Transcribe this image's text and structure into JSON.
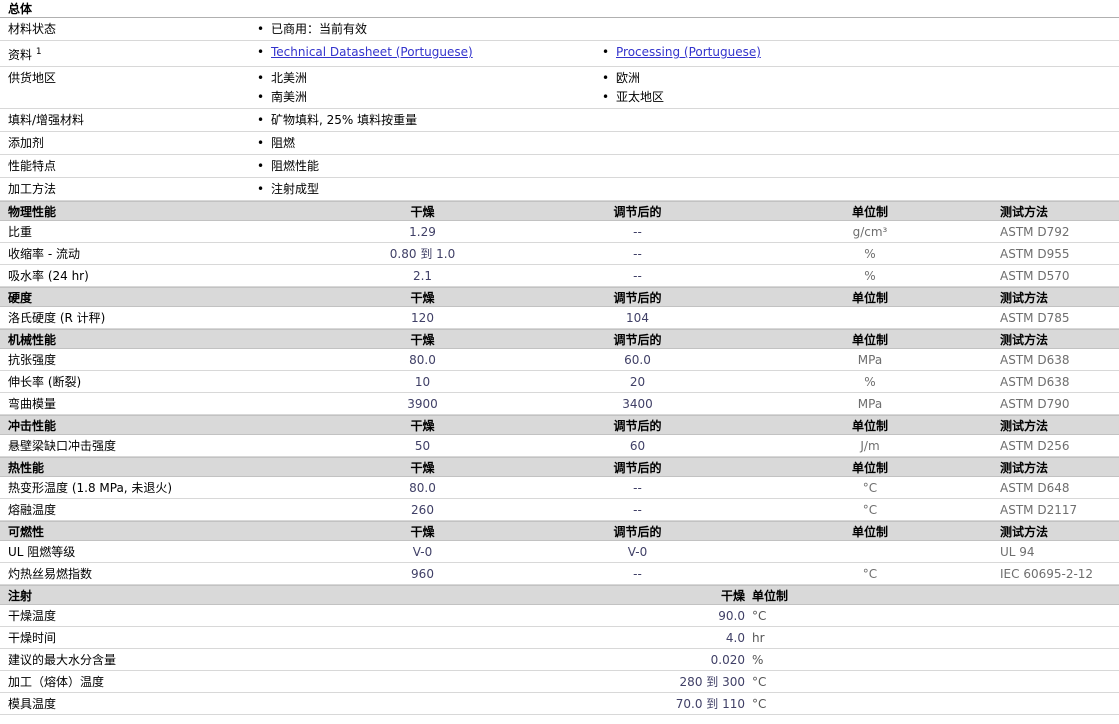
{
  "columns": {
    "dry": "干燥",
    "conditioned": "调节后的",
    "unit": "单位制",
    "method": "测试方法"
  },
  "general": {
    "title": "总体",
    "material_status": {
      "label": "材料状态",
      "value": "已商用：当前有效"
    },
    "resources": {
      "label": "资料",
      "sup": "1",
      "link1": "Technical Datasheet (Portuguese)",
      "link2": "Processing (Portuguese)"
    },
    "availability": {
      "label": "供货地区",
      "col1_0": "北美洲",
      "col1_1": "南美洲",
      "col2_0": "欧洲",
      "col2_1": "亚太地区"
    },
    "filler": {
      "label": "填料/增强材料",
      "value": "矿物填料, 25% 填料按重量"
    },
    "additive": {
      "label": "添加剂",
      "value": "阻燃"
    },
    "features": {
      "label": "性能特点",
      "value": "阻燃性能"
    },
    "processing_method": {
      "label": "加工方法",
      "value": "注射成型"
    }
  },
  "sections": [
    {
      "title": "物理性能",
      "rows": [
        {
          "property": "比重",
          "dry": "1.29",
          "conditioned": "--",
          "unit": "g/cm³",
          "method": "ASTM D792"
        },
        {
          "property": "收缩率 - 流动",
          "dry": "0.80 到 1.0",
          "conditioned": "--",
          "unit": "%",
          "method": "ASTM D955"
        },
        {
          "property": "吸水率 (24 hr)",
          "dry": "2.1",
          "conditioned": "--",
          "unit": "%",
          "method": "ASTM D570"
        }
      ]
    },
    {
      "title": "硬度",
      "rows": [
        {
          "property": "洛氏硬度 (R 计秤)",
          "dry": "120",
          "conditioned": "104",
          "unit": "",
          "method": "ASTM D785"
        }
      ]
    },
    {
      "title": "机械性能",
      "rows": [
        {
          "property": "抗张强度",
          "dry": "80.0",
          "conditioned": "60.0",
          "unit": "MPa",
          "method": "ASTM D638"
        },
        {
          "property": "伸长率 (断裂)",
          "dry": "10",
          "conditioned": "20",
          "unit": "%",
          "method": "ASTM D638"
        },
        {
          "property": "弯曲模量",
          "dry": "3900",
          "conditioned": "3400",
          "unit": "MPa",
          "method": "ASTM D790"
        }
      ]
    },
    {
      "title": "冲击性能",
      "rows": [
        {
          "property": "悬壁梁缺口冲击强度",
          "dry": "50",
          "conditioned": "60",
          "unit": "J/m",
          "method": "ASTM D256"
        }
      ]
    },
    {
      "title": "热性能",
      "rows": [
        {
          "property": "热变形温度 (1.8 MPa, 未退火)",
          "dry": "80.0",
          "conditioned": "--",
          "unit": "°C",
          "method": "ASTM D648"
        },
        {
          "property": "熔融温度",
          "dry": "260",
          "conditioned": "--",
          "unit": "°C",
          "method": "ASTM D2117"
        }
      ]
    },
    {
      "title": "可燃性",
      "rows": [
        {
          "property": "UL 阻燃等级",
          "dry": "V-0",
          "conditioned": "V-0",
          "unit": "",
          "method": "UL 94"
        },
        {
          "property": "灼热丝易燃指数",
          "dry": "960",
          "conditioned": "--",
          "unit": "°C",
          "method": "IEC 60695-2-12"
        }
      ]
    }
  ],
  "injection": {
    "title": "注射",
    "header_dry": "干燥",
    "header_unit": "单位制",
    "rows": [
      {
        "label": "干燥温度",
        "value": "90.0",
        "unit": "°C"
      },
      {
        "label": "干燥时间",
        "value": "4.0",
        "unit": "hr"
      },
      {
        "label": "建议的最大水分含量",
        "value": "0.020",
        "unit": "%"
      },
      {
        "label": "加工（熔体）温度",
        "value": "280 到 300",
        "unit": "°C"
      },
      {
        "label": "模具温度",
        "value": "70.0 到 110",
        "unit": "°C"
      }
    ]
  },
  "colors": {
    "value_text": "#3f3f66",
    "muted_text": "#6e6e6e",
    "link": "#3333cc",
    "section_header_bg": "#d9d9d9"
  }
}
